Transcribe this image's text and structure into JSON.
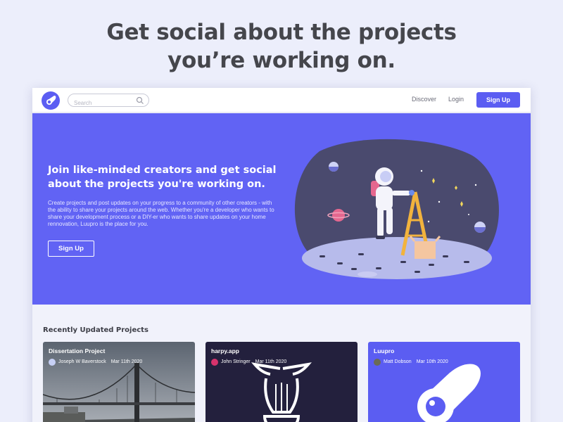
{
  "headline": {
    "line1": "Get social about the projects",
    "line2": "you’re working on."
  },
  "nav": {
    "search_placeholder": "Search",
    "discover": "Discover",
    "login": "Login",
    "signup": "Sign Up"
  },
  "hero": {
    "title": "Join like-minded creators and get social about the projects you're working on.",
    "body": "Create projects and post updates on your progress to a community of other creators - with the ability to share your projects around the web. Whether you're a developer who wants to share your development process or a DIY-er who wants to share updates on your home rennovation, Luupro is the place for you.",
    "button": "Sign Up"
  },
  "projects": {
    "section_title": "Recently Updated Projects",
    "items": [
      {
        "title": "Dissertation Project",
        "author": "Joseph W Baverstock",
        "date": "Mar 11th 2020",
        "avatar_color": "#c7d0f5"
      },
      {
        "title": "harpy.app",
        "author": "John Stringer",
        "date": "Mar 11th 2020",
        "avatar_color": "#d6336c"
      },
      {
        "title": "Luupro",
        "author": "Matt Dobson",
        "date": "Mar 10th 2020",
        "avatar_color": "#6b6b55"
      }
    ]
  },
  "colors": {
    "accent": "#5b5df2",
    "hero_bg": "#6163f4",
    "page_bg": "#eceefb",
    "harpy_bg": "#23203d"
  },
  "icons": {
    "logo": "luupro-rocket-logo",
    "search": "search-icon"
  }
}
